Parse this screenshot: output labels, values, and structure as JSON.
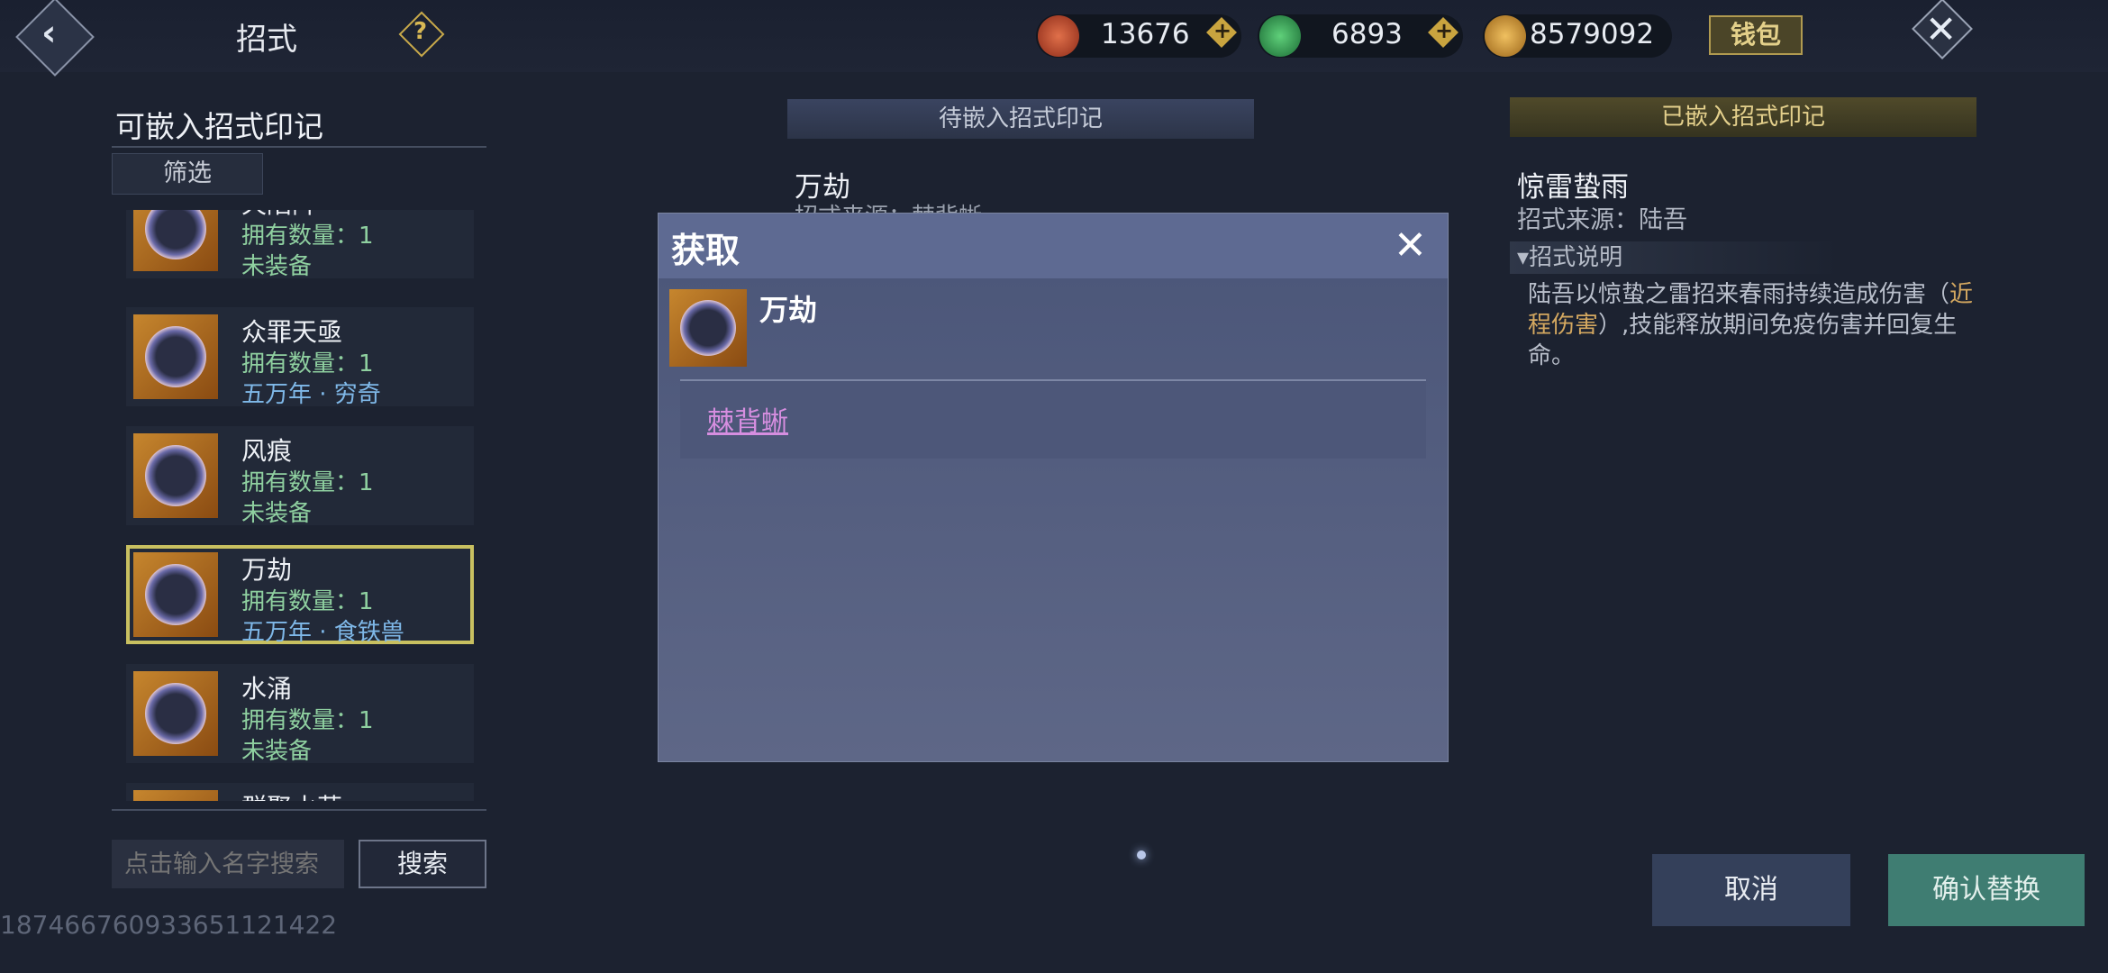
{
  "header": {
    "title": "招式",
    "back_icon": "back-arrow-icon",
    "help_icon": "question-icon"
  },
  "currencies": [
    {
      "icon": "red-coin-icon",
      "color": "#c0452a",
      "value": "13676"
    },
    {
      "icon": "jade-coin-icon",
      "color": "#2e9a52",
      "value": "6893"
    },
    {
      "icon": "gold-token-icon",
      "color": "#c8922e",
      "value": "8579092"
    }
  ],
  "wallet_label": "钱包",
  "left_panel": {
    "title": "可嵌入招式印记",
    "filter_label": "筛选",
    "items": [
      {
        "name": "天陷阵",
        "count": "拥有数量：1",
        "status": "未装备",
        "status_kind": "green"
      },
      {
        "name": "众罪天亟",
        "count": "拥有数量：1",
        "status": "五万年 · 穷奇",
        "status_kind": "blue"
      },
      {
        "name": "风痕",
        "count": "拥有数量：1",
        "status": "未装备",
        "status_kind": "green"
      },
      {
        "name": "万劫",
        "count": "拥有数量：1",
        "status": "五万年 · 食铁兽",
        "status_kind": "blue",
        "selected": true
      },
      {
        "name": "水涌",
        "count": "拥有数量：1",
        "status": "未装备",
        "status_kind": "green"
      },
      {
        "name": "群聚水草",
        "count": "",
        "status": "",
        "status_kind": "green"
      }
    ],
    "search_placeholder": "点击输入名字搜索",
    "search_label": "搜索"
  },
  "user_id": "18746676093365112142​2",
  "middle": {
    "header": "待嵌入招式印记",
    "name": "万劫",
    "source": "招式来源：棘背蜥"
  },
  "right": {
    "header": "已嵌入招式印记",
    "name": "惊雷蛰雨",
    "source": "招式来源：陆吾",
    "desc_header": "招式说明",
    "desc_part1": "陆吾以惊蛰之雷招来春雨持续造成伤害（",
    "desc_highlight": "近程伤害",
    "desc_part2": "）,技能释放期间免疫伤害并回复生命。"
  },
  "buttons": {
    "cancel": "取消",
    "confirm": "确认替换"
  },
  "dialog": {
    "title": "获取",
    "item_name": "万劫",
    "source_link": "棘背蜥"
  }
}
